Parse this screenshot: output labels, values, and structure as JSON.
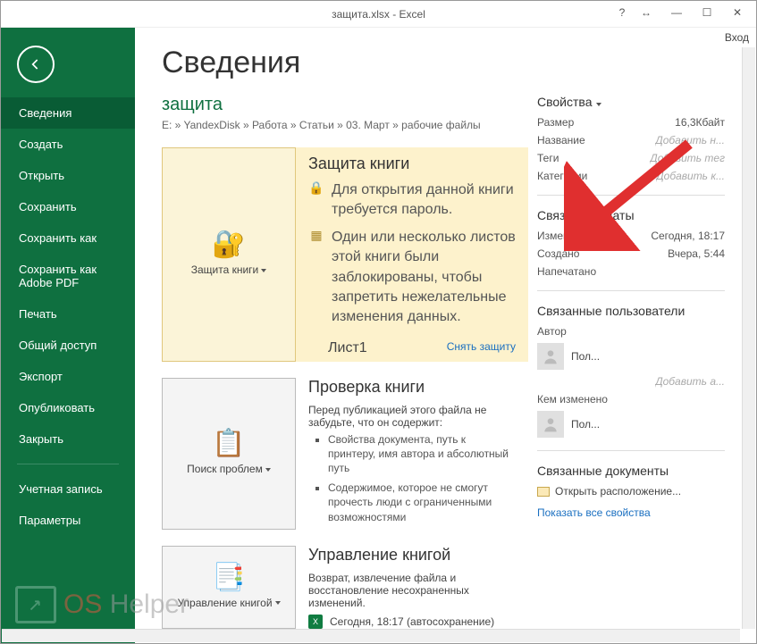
{
  "titlebar": {
    "title": "защита.xlsx - Excel",
    "login": "Вход"
  },
  "sidebar": {
    "items": [
      "Сведения",
      "Создать",
      "Открыть",
      "Сохранить",
      "Сохранить как",
      "Сохранить как Adobe PDF",
      "Печать",
      "Общий доступ",
      "Экспорт",
      "Опубликовать",
      "Закрыть"
    ],
    "footer": [
      "Учетная запись",
      "Параметры"
    ],
    "active": 0
  },
  "page": {
    "heading": "Сведения",
    "filename": "защита",
    "breadcrumb": "E: » YandexDisk » Работа » Статьи » 03. Март » рабочие файлы"
  },
  "protect": {
    "button": "Защита книги",
    "title": "Защита книги",
    "msg_password": "Для открытия данной книги требуется пароль.",
    "msg_sheets": "Один или несколько листов этой книги были заблокированы, чтобы запретить нежелательные изменения данных.",
    "sheet_name": "Лист1",
    "unprotect": "Снять защиту"
  },
  "inspect": {
    "button": "Поиск проблем",
    "title": "Проверка книги",
    "intro": "Перед публикацией этого файла не забудьте, что он содержит:",
    "bullets": [
      "Свойства документа, путь к принтеру, имя автора и абсолютный путь",
      "Содержимое, которое не смогут прочесть люди с ограниченными возможностями"
    ]
  },
  "manage": {
    "button": "Управление книгой",
    "title": "Управление книгой",
    "intro": "Возврат, извлечение файла и восстановление несохраненных изменений.",
    "autosave": "Сегодня, 18:17 (автосохранение)"
  },
  "props": {
    "heading": "Свойства",
    "rows": [
      {
        "k": "Размер",
        "v": "16,3Кбайт",
        "ph": false
      },
      {
        "k": "Название",
        "v": "Добавить н...",
        "ph": true
      },
      {
        "k": "Теги",
        "v": "Добавить тег",
        "ph": true
      },
      {
        "k": "Категории",
        "v": "Добавить к...",
        "ph": true
      }
    ],
    "dates_heading": "Связанные даты",
    "dates": [
      {
        "k": "Изменено",
        "v": "Сегодня, 18:17"
      },
      {
        "k": "Создано",
        "v": "Вчера, 5:44"
      },
      {
        "k": "Напечатано",
        "v": ""
      }
    ],
    "users_heading": "Связанные пользователи",
    "author_label": "Автор",
    "author_name": "Пол...",
    "add_author": "Добавить а...",
    "modified_by_label": "Кем изменено",
    "modified_by_name": "Пол...",
    "docs_heading": "Связанные документы",
    "open_location": "Открыть расположение...",
    "show_all": "Показать все свойства"
  }
}
